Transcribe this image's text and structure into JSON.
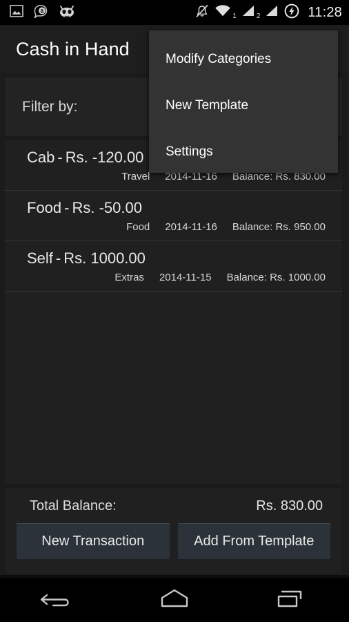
{
  "status_bar": {
    "icons_left": [
      "image-icon",
      "chat-bubble-8-icon",
      "cyanogenmod-cid-icon"
    ],
    "chat_badge": "8",
    "icons_right": [
      "mute-icon",
      "wifi-icon",
      "signal-1-icon",
      "signal-2-icon",
      "charging-bolt-icon"
    ],
    "sim1_label": "1",
    "sim2_label": "2",
    "clock": "11:28"
  },
  "action_bar": {
    "title": "Cash in Hand"
  },
  "overflow_menu": {
    "items": [
      {
        "label": "Modify Categories"
      },
      {
        "label": "New Template"
      },
      {
        "label": "Settings"
      }
    ]
  },
  "filter": {
    "label": "Filter by:"
  },
  "transactions": {
    "separator": "-",
    "rows": [
      {
        "name": "Cab",
        "amount": "Rs. -120.00",
        "category": "Travel",
        "date": "2014-11-16",
        "balance": "Balance: Rs. 830.00"
      },
      {
        "name": "Food",
        "amount": "Rs. -50.00",
        "category": "Food",
        "date": "2014-11-16",
        "balance": "Balance: Rs. 950.00"
      },
      {
        "name": "Self",
        "amount": "Rs. 1000.00",
        "category": "Extras",
        "date": "2014-11-15",
        "balance": "Balance: Rs. 1000.00"
      }
    ]
  },
  "footer": {
    "total_label": "Total Balance:",
    "total_value": "Rs. 830.00",
    "new_transaction_label": "New Transaction",
    "add_from_template_label": "Add From Template"
  },
  "nav_bar": {
    "back": "back-icon",
    "home": "home-icon",
    "recents": "recents-icon"
  },
  "colors": {
    "screen_bg": "#1b1b1b",
    "panel_bg": "#202020",
    "action_bar_bg": "#1e1e1e",
    "menu_bg": "#333333",
    "button_bg": "#2b3239",
    "text_primary": "#ffffff",
    "text_secondary": "#d6d6d6",
    "divider": "#343434"
  }
}
